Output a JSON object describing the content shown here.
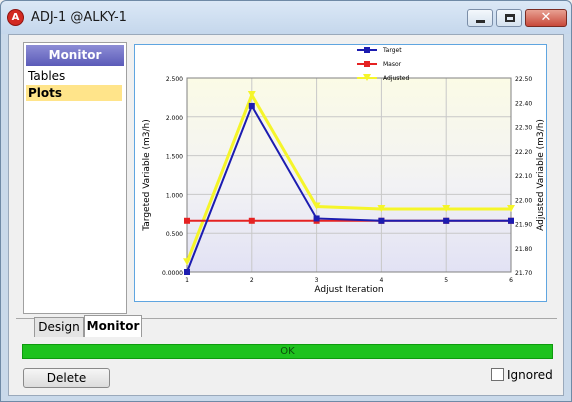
{
  "window": {
    "title": "ADJ-1 @ALKY-1",
    "app_icon_letter": "A",
    "close_glyph": "✕"
  },
  "monitor": {
    "header": "Monitor",
    "items": [
      {
        "label": "Tables",
        "selected": false
      },
      {
        "label": "Plots",
        "selected": true
      }
    ]
  },
  "tabs": [
    {
      "label": "Design",
      "active": false
    },
    {
      "label": "Monitor",
      "active": true
    }
  ],
  "status": {
    "text": "OK",
    "color": "#1ec21e"
  },
  "delete_label": "Delete",
  "ignored": {
    "label": "Ignored",
    "checked": false
  },
  "chart_data": {
    "type": "line",
    "xlabel": "Adjust Iteration",
    "ylabel_left": "Targeted Variable (m3/h)",
    "ylabel_right": "Adjusted Variable (m3/h)",
    "x": [
      1,
      2,
      3,
      4,
      5,
      6
    ],
    "x_ticks": [
      "1",
      "2",
      "3",
      "4",
      "5",
      "6"
    ],
    "ylim_left": [
      0,
      2.5
    ],
    "y_ticks_left": [
      "0.0000",
      "0.500",
      "1.000",
      "1.500",
      "2.000",
      "2.500"
    ],
    "ylim_right": [
      21.7,
      22.5
    ],
    "y_ticks_right": [
      "21.70",
      "21.80",
      "21.90",
      "22.00",
      "22.10",
      "22.20",
      "22.30",
      "22.40",
      "22.50"
    ],
    "grid": true,
    "legend_position": "top-center",
    "series": [
      {
        "name": "Target",
        "axis": "left",
        "color": "#1c1cb0",
        "values": [
          0.0,
          2.14,
          0.69,
          0.66,
          0.66,
          0.66
        ]
      },
      {
        "name": "Masor",
        "axis": "left",
        "color": "#e52222",
        "values": [
          0.66,
          0.66,
          0.66,
          0.66,
          0.66,
          0.66
        ]
      },
      {
        "name": "Adjusted",
        "axis": "right",
        "color": "#f5f52a",
        "values": [
          21.74,
          22.43,
          21.97,
          21.96,
          21.96,
          21.96
        ]
      }
    ]
  }
}
